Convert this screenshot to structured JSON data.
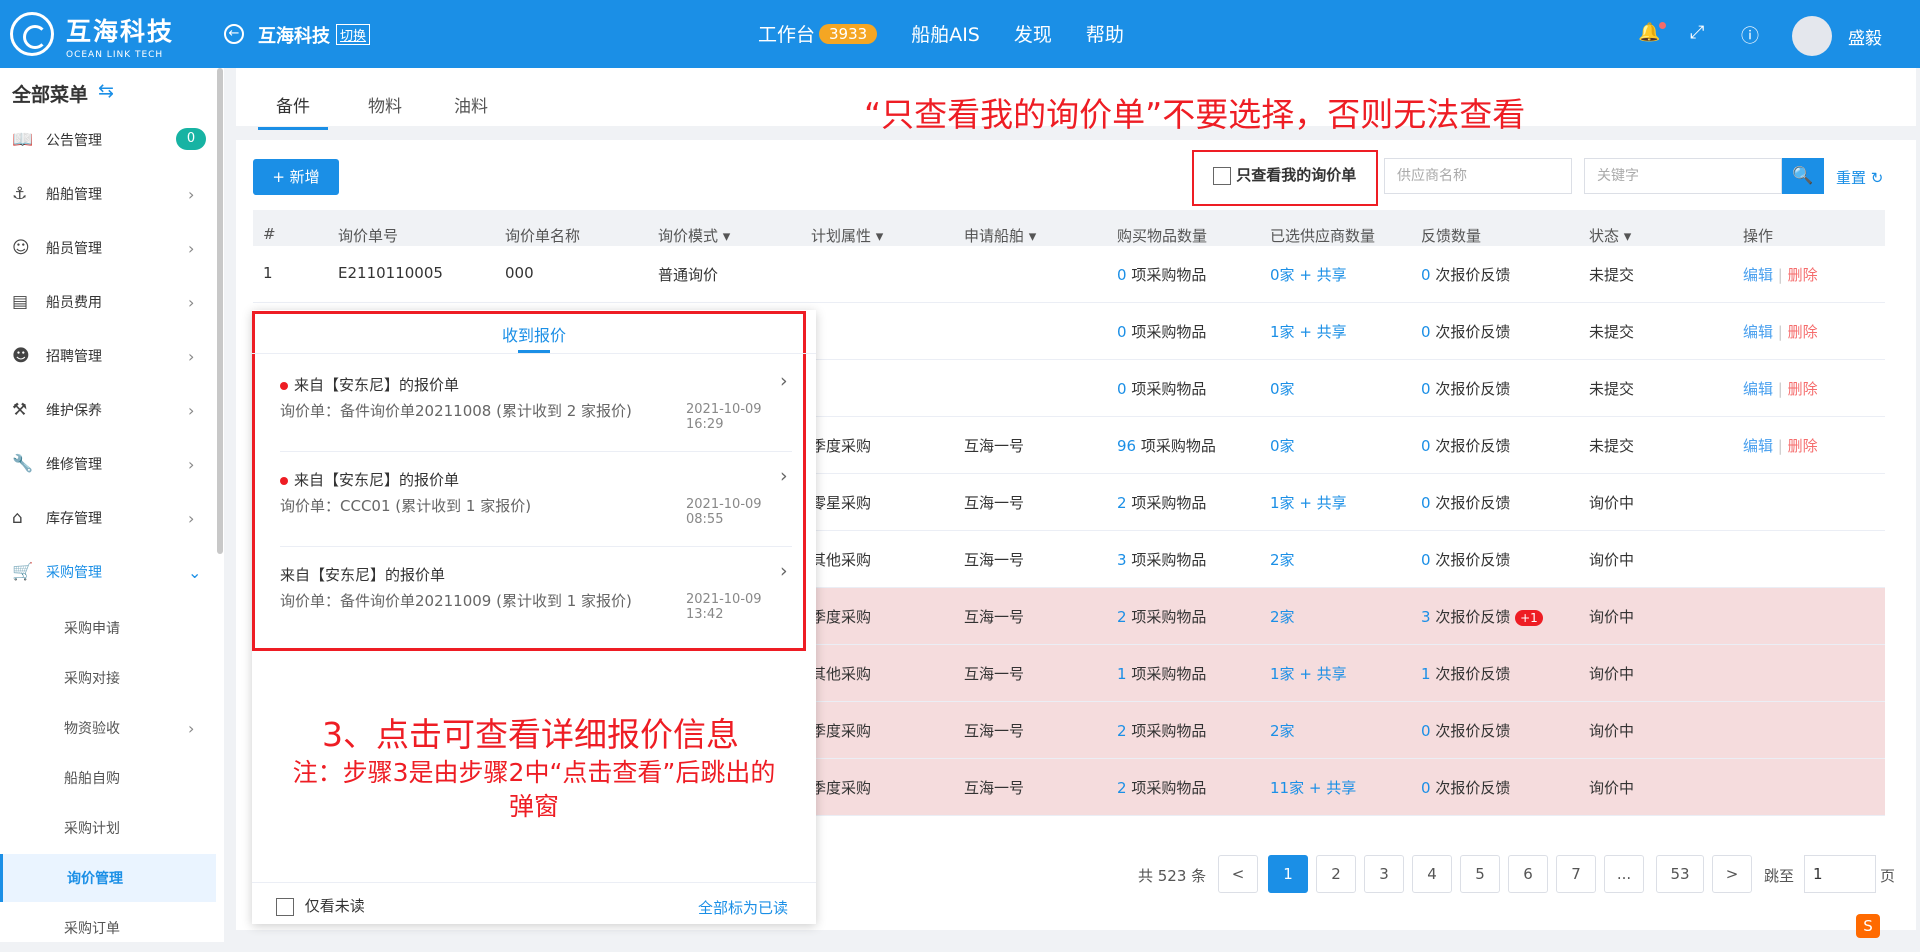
{
  "header": {
    "logo_main": "互海科技",
    "logo_sub": "OCEAN LINK TECH",
    "company": "互海科技",
    "switch_label": "切换",
    "nav": [
      {
        "label": "工作台",
        "badge": "3933"
      },
      {
        "label": "船舶AIS"
      },
      {
        "label": "发现"
      },
      {
        "label": "帮助"
      }
    ],
    "username": "盛毅",
    "icons": [
      "bell-icon",
      "fullscreen-icon",
      "help-icon"
    ]
  },
  "sidebar": {
    "title": "全部菜单",
    "items": [
      {
        "label": "公告管理",
        "icon": "announcement-icon",
        "count": "0"
      },
      {
        "label": "船舶管理",
        "icon": "anchor-icon"
      },
      {
        "label": "船员管理",
        "icon": "person-icon"
      },
      {
        "label": "船员费用",
        "icon": "wallet-icon"
      },
      {
        "label": "招聘管理",
        "icon": "recruit-icon"
      },
      {
        "label": "维护保养",
        "icon": "maintenance-icon"
      },
      {
        "label": "维修管理",
        "icon": "wrench-icon"
      },
      {
        "label": "库存管理",
        "icon": "warehouse-icon"
      },
      {
        "label": "采购管理",
        "icon": "cart-icon"
      }
    ],
    "sub_items": [
      "采购申请",
      "采购对接",
      "物资验收",
      "船舶自购",
      "采购计划",
      "询价管理",
      "采购订单"
    ]
  },
  "tabs": [
    "备件",
    "物料",
    "油料"
  ],
  "annotation_top": "“只查看我的询价单”不要选择，否则无法查看",
  "toolbar": {
    "add_label": "新增",
    "only_mine_label": "只查看我的询价单",
    "supplier_placeholder": "供应商名称",
    "keyword_placeholder": "关键字",
    "reset_label": "重置"
  },
  "table": {
    "headers": [
      "#",
      "询价单号",
      "询价单名称",
      "询价模式",
      "计划属性",
      "申请船舶",
      "购买物品数量",
      "已选供应商数量",
      "反馈数量",
      "状态",
      "操作"
    ],
    "rows": [
      {
        "idx": "1",
        "no": "E2110110005",
        "name": "000",
        "mode": "普通询价",
        "plan": "",
        "ship": "",
        "items_n": "0",
        "items_t": "项采购物品",
        "sup_n": "0家",
        "sup_share": "+ 共享",
        "fb_n": "0",
        "fb_t": "次报价反馈",
        "fb_badge": "",
        "status": "未提交",
        "edit": "编辑",
        "del": "删除"
      },
      {
        "idx": "",
        "no": "",
        "name": "",
        "mode": "",
        "plan": "",
        "ship": "",
        "items_n": "0",
        "items_t": "项采购物品",
        "sup_n": "1家",
        "sup_share": "+ 共享",
        "fb_n": "0",
        "fb_t": "次报价反馈",
        "fb_badge": "",
        "status": "未提交",
        "edit": "编辑",
        "del": "删除"
      },
      {
        "idx": "",
        "no": "",
        "name": "",
        "mode": "",
        "plan": "",
        "ship": "",
        "items_n": "0",
        "items_t": "项采购物品",
        "sup_n": "0家",
        "sup_share": "",
        "fb_n": "0",
        "fb_t": "次报价反馈",
        "fb_badge": "",
        "status": "未提交",
        "edit": "编辑",
        "del": "删除"
      },
      {
        "idx": "",
        "no": "",
        "name": "",
        "mode": "",
        "plan": "季度采购",
        "ship": "互海一号",
        "items_n": "96",
        "items_t": "项采购物品",
        "sup_n": "0家",
        "sup_share": "",
        "fb_n": "0",
        "fb_t": "次报价反馈",
        "fb_badge": "",
        "status": "未提交",
        "edit": "编辑",
        "del": "删除"
      },
      {
        "idx": "",
        "no": "",
        "name": "",
        "mode": "",
        "plan": "零星采购",
        "ship": "互海一号",
        "items_n": "2",
        "items_t": "项采购物品",
        "sup_n": "1家",
        "sup_share": "+ 共享",
        "fb_n": "0",
        "fb_t": "次报价反馈",
        "fb_badge": "",
        "status": "询价中",
        "edit": "",
        "del": ""
      },
      {
        "idx": "",
        "no": "",
        "name": "",
        "mode": "",
        "plan": "其他采购",
        "ship": "互海一号",
        "items_n": "3",
        "items_t": "项采购物品",
        "sup_n": "2家",
        "sup_share": "",
        "fb_n": "0",
        "fb_t": "次报价反馈",
        "fb_badge": "",
        "status": "询价中",
        "edit": "",
        "del": ""
      },
      {
        "idx": "",
        "no": "",
        "name": "",
        "mode": "",
        "plan": "季度采购",
        "ship": "互海一号",
        "items_n": "2",
        "items_t": "项采购物品",
        "sup_n": "2家",
        "sup_share": "",
        "fb_n": "3",
        "fb_t": "次报价反馈",
        "fb_badge": "+1",
        "status": "询价中",
        "edit": "",
        "del": ""
      },
      {
        "idx": "",
        "no": "",
        "name": "",
        "mode": "",
        "plan": "其他采购",
        "ship": "互海一号",
        "items_n": "1",
        "items_t": "项采购物品",
        "sup_n": "1家",
        "sup_share": "+ 共享",
        "fb_n": "1",
        "fb_t": "次报价反馈",
        "fb_badge": "",
        "status": "询价中",
        "edit": "",
        "del": ""
      },
      {
        "idx": "",
        "no": "",
        "name": "",
        "mode": "",
        "plan": "季度采购",
        "ship": "互海一号",
        "items_n": "2",
        "items_t": "项采购物品",
        "sup_n": "2家",
        "sup_share": "",
        "fb_n": "0",
        "fb_t": "次报价反馈",
        "fb_badge": "",
        "status": "询价中",
        "edit": "",
        "del": ""
      },
      {
        "idx": "",
        "no": "",
        "name": "",
        "mode": "",
        "plan": "季度采购",
        "ship": "互海一号",
        "items_n": "2",
        "items_t": "项采购物品",
        "sup_n": "11家",
        "sup_share": "+ 共享",
        "fb_n": "0",
        "fb_t": "次报价反馈",
        "fb_badge": "",
        "status": "询价中",
        "edit": "",
        "del": ""
      }
    ]
  },
  "popup": {
    "title": "收到报价",
    "messages": [
      {
        "title": "来自【安东尼】的报价单",
        "sub": "询价单：备件询价单20211008 (累计收到 2 家报价)",
        "time": "2021-10-09 16:29",
        "unread": true
      },
      {
        "title": "来自【安东尼】的报价单",
        "sub": "询价单：CCC01 (累计收到 1 家报价)",
        "time": "2021-10-09 08:55",
        "unread": true
      },
      {
        "title": "来自【安东尼】的报价单",
        "sub": "询价单：备件询价单20211009 (累计收到 1 家报价)",
        "time": "2021-10-09 13:42",
        "unread": false
      }
    ],
    "annotation_main": "3、点击可查看详细报价信息",
    "annotation_note_1": "注：步骤3是由步骤2中“点击查看”后跳出的",
    "annotation_note_2": "弹窗",
    "only_unread_label": "仅看未读",
    "mark_all_label": "全部标为已读"
  },
  "pagination": {
    "total": "共 523 条",
    "pages": [
      "1",
      "2",
      "3",
      "4",
      "5",
      "6",
      "7",
      "...",
      "53"
    ],
    "current": "1",
    "prev": "<",
    "next": ">",
    "goto_label": "跳至",
    "goto_value": "1",
    "page_suffix": "页"
  },
  "colors": {
    "primary": "#1b8fe6",
    "annotation_red": "#ee1d24",
    "highlight_row": "#f5dcdd",
    "danger": "#f56c6c"
  }
}
